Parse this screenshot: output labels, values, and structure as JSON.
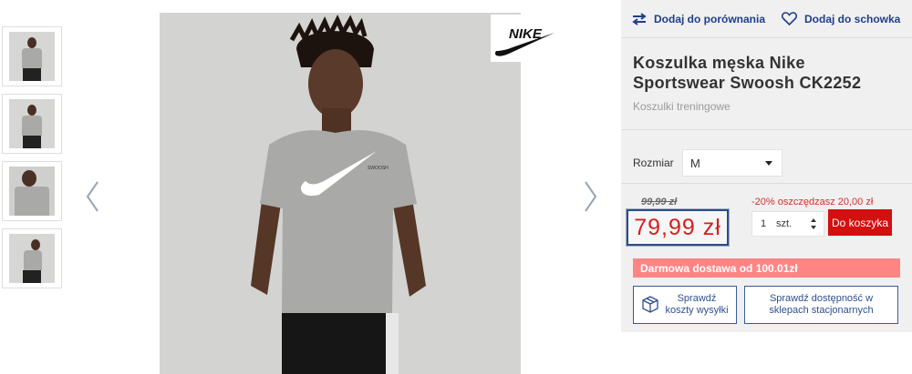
{
  "thumbnails": [
    {
      "name": "thumb-front"
    },
    {
      "name": "thumb-back"
    },
    {
      "name": "thumb-closeup"
    },
    {
      "name": "thumb-side"
    }
  ],
  "brand_logo": "NIKE",
  "panel": {
    "compare_label": "Dodaj do porównania",
    "wishlist_label": "Dodaj do schowka",
    "title": "Koszulka męska Nike Sportswear Swoosh CK2252",
    "category": "Koszulki treningowe",
    "size_label": "Rozmiar",
    "size_value": "M",
    "old_price": "99,99 zł",
    "saving": "-20% oszczędzasz 20,00 zł",
    "price": "79,99 zł",
    "qty_value": "1",
    "qty_unit": "szt.",
    "add_to_cart": "Do koszyka",
    "free_shipping": "Darmowa dostawa od 100.01zł",
    "check_shipping": "Sprawdź koszty wysyłki",
    "check_stores": "Sprawdź dostępność w sklepach stacjonarnych"
  },
  "shirt_print": "SWOOSH",
  "colors": {
    "accent_blue": "#1f3f8a",
    "price_red": "#d32020",
    "button_red": "#d40f0f",
    "free_ship_bg": "#ff8585",
    "panel_bg": "#f0f0f0"
  },
  "icons": [
    "compare-arrows-icon",
    "heart-icon",
    "chevron-left-icon",
    "chevron-right-icon",
    "box-icon",
    "caret-down-icon"
  ]
}
